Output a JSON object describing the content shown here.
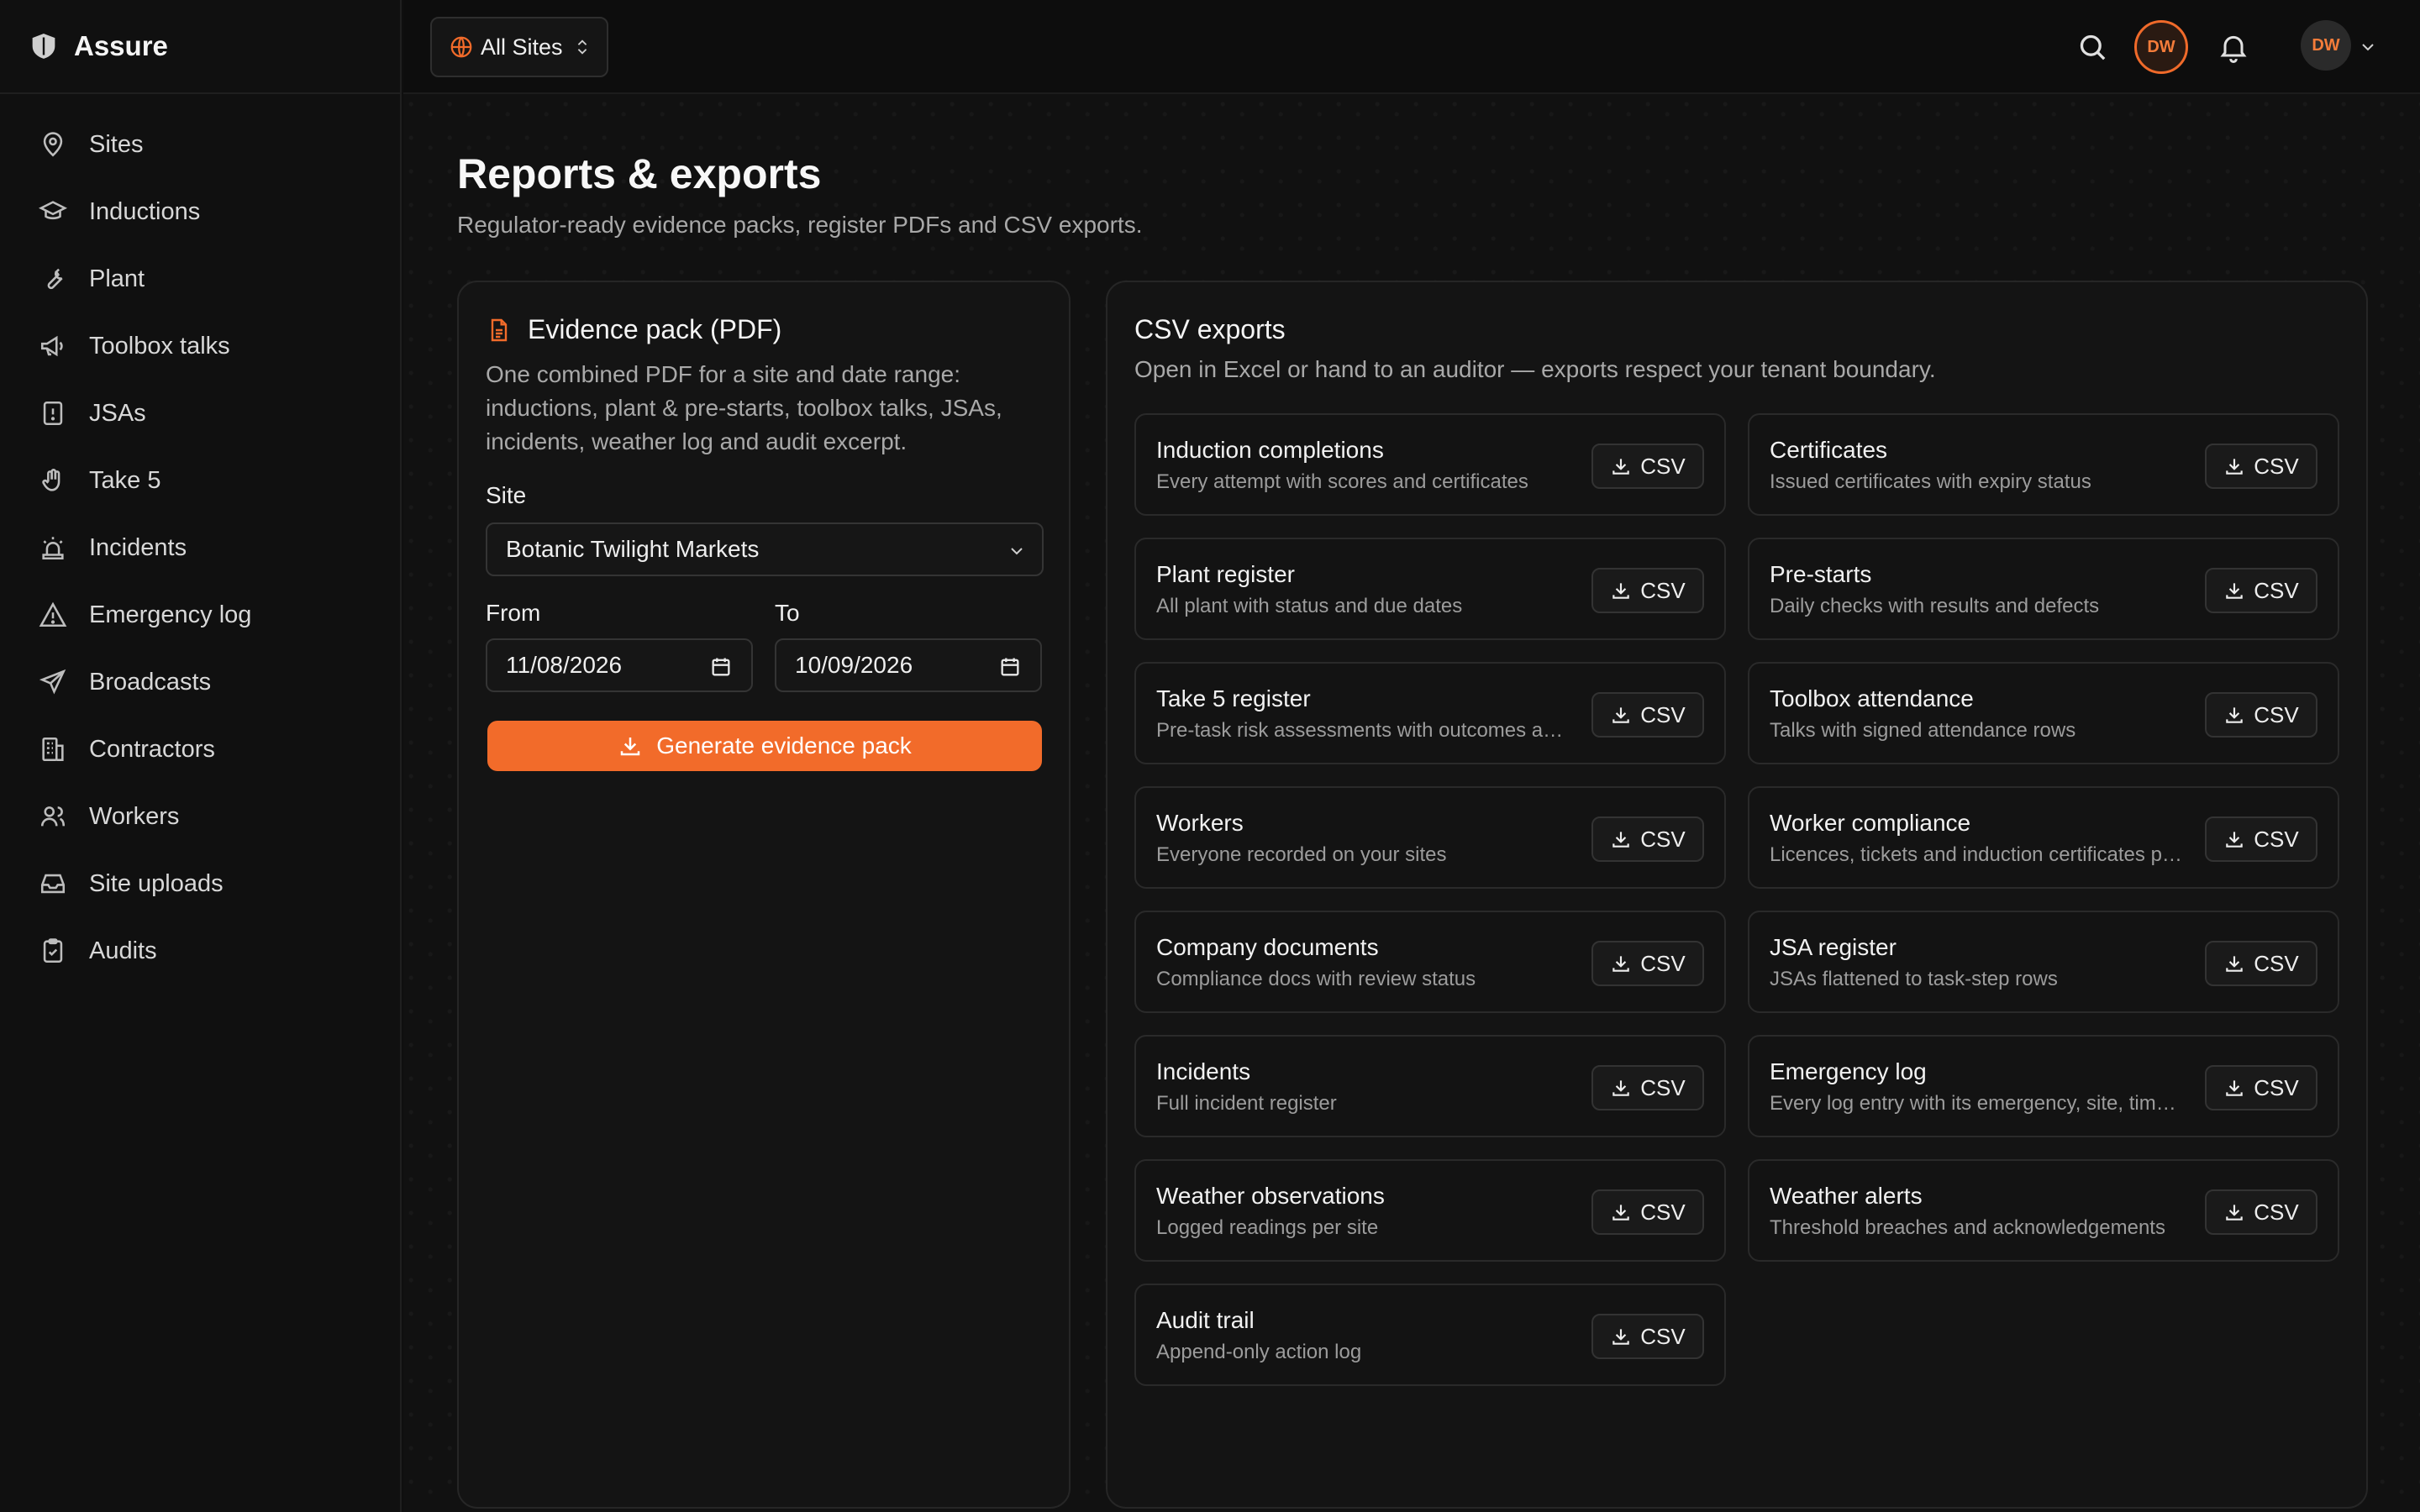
{
  "app": {
    "name": "Assure"
  },
  "sidebar": {
    "items": [
      {
        "label": "Sites",
        "icon": "map-pin-icon"
      },
      {
        "label": "Inductions",
        "icon": "graduation-cap-icon"
      },
      {
        "label": "Plant",
        "icon": "wrench-icon"
      },
      {
        "label": "Toolbox talks",
        "icon": "megaphone-icon"
      },
      {
        "label": "JSAs",
        "icon": "file-alert-icon"
      },
      {
        "label": "Take 5",
        "icon": "hand-icon"
      },
      {
        "label": "Incidents",
        "icon": "siren-icon"
      },
      {
        "label": "Emergency log",
        "icon": "warning-icon"
      },
      {
        "label": "Broadcasts",
        "icon": "send-icon"
      },
      {
        "label": "Contractors",
        "icon": "building-icon"
      },
      {
        "label": "Workers",
        "icon": "users-icon"
      },
      {
        "label": "Site uploads",
        "icon": "inbox-icon"
      },
      {
        "label": "Audits",
        "icon": "clipboard-check-icon"
      }
    ]
  },
  "topbar": {
    "site_switch": "All Sites",
    "avatar_initials": "DW",
    "user_initials": "DW",
    "accent": "#f26b2a"
  },
  "page": {
    "title": "Reports & exports",
    "subtitle": "Regulator-ready evidence packs, register PDFs and CSV exports."
  },
  "evidence": {
    "title": "Evidence pack (PDF)",
    "description": "One combined PDF for a site and date range: inductions, plant & pre-starts, toolbox talks, JSAs, incidents, weather log and audit excerpt.",
    "site_label": "Site",
    "site_value": "Botanic Twilight Markets",
    "from_label": "From",
    "from_value": "11/08/2026",
    "to_label": "To",
    "to_value": "10/09/2026",
    "button": "Generate evidence pack"
  },
  "csv": {
    "title": "CSV exports",
    "subtitle": "Open in Excel or hand to an auditor — exports respect your tenant boundary.",
    "button_label": "CSV",
    "items": [
      {
        "title": "Induction completions",
        "desc": "Every attempt with scores and certificates"
      },
      {
        "title": "Certificates",
        "desc": "Issued certificates with expiry status"
      },
      {
        "title": "Plant register",
        "desc": "All plant with status and due dates"
      },
      {
        "title": "Pre-starts",
        "desc": "Daily checks with results and defects"
      },
      {
        "title": "Take 5 register",
        "desc": "Pre-task risk assessments with outcomes and sign-off"
      },
      {
        "title": "Toolbox attendance",
        "desc": "Talks with signed attendance rows"
      },
      {
        "title": "Workers",
        "desc": "Everyone recorded on your sites"
      },
      {
        "title": "Worker compliance",
        "desc": "Licences, tickets and induction certificates per worker"
      },
      {
        "title": "Company documents",
        "desc": "Compliance docs with review status"
      },
      {
        "title": "JSA register",
        "desc": "JSAs flattened to task-step rows"
      },
      {
        "title": "Incidents",
        "desc": "Full incident register"
      },
      {
        "title": "Emergency log",
        "desc": "Every log entry with its emergency, site, time and author"
      },
      {
        "title": "Weather observations",
        "desc": "Logged readings per site"
      },
      {
        "title": "Weather alerts",
        "desc": "Threshold breaches and acknowledgements"
      },
      {
        "title": "Audit trail",
        "desc": "Append-only action log"
      }
    ]
  }
}
